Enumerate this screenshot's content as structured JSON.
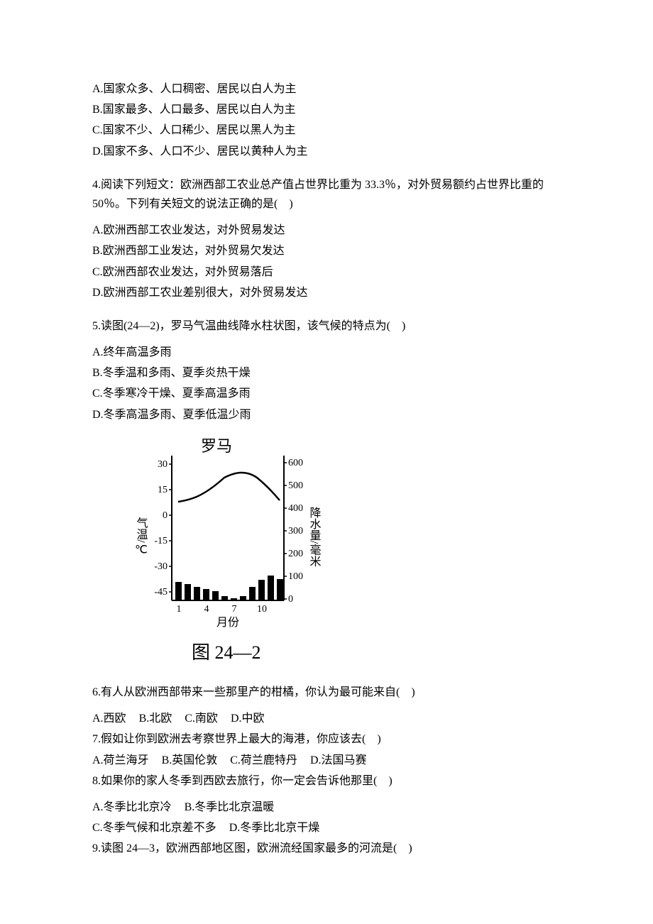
{
  "q3_options": {
    "A": "A.国家众多、人口稠密、居民以白人为主",
    "B": "B.国家最多、人口最多、居民以白人为主",
    "C": "C.国家不少、人口稀少、居民以黑人为主",
    "D": "D.国家不多、人口不少、居民以黄种人为主"
  },
  "q4": {
    "stem": "4.阅读下列短文：欧洲西部工农业总产值占世界比重为 33.3％，对外贸易额约占世界比重的 50％。下列有关短文的说法正确的是(　)",
    "A": "A.欧洲西部工农业发达，对外贸易发达",
    "B": "B.欧洲西部工业发达，对外贸易欠发达",
    "C": "C.欧洲西部农业发达，对外贸易落后",
    "D": "D.欧洲西部工农业差别很大，对外贸易发达"
  },
  "q5": {
    "stem": "5.读图(24—2)，罗马气温曲线降水柱状图，该气候的特点为(　)",
    "A": "A.终年高温多雨",
    "B": "B.冬季温和多雨、夏季炎热干燥",
    "C": "C.冬季寒冷干燥、夏季高温多雨",
    "D": "D.冬季高温多雨、夏季低温少雨"
  },
  "chart": {
    "title": "罗马",
    "caption": "图 24—2",
    "xlabel": "月份",
    "ylabel_left": "气温/℃",
    "ylabel_right": "降水量/毫米",
    "x_ticks": [
      "1",
      "4",
      "7",
      "10"
    ],
    "left_ticks": [
      "30",
      "15",
      "0",
      "-15",
      "-30",
      "-45"
    ],
    "right_ticks": [
      "600",
      "500",
      "400",
      "300",
      "200",
      "100",
      "0"
    ]
  },
  "chart_data": {
    "type": "bar",
    "title": "罗马",
    "xlabel": "月份",
    "ylabel_left": "气温/℃",
    "ylabel_right": "降水量/毫米",
    "categories": [
      1,
      2,
      3,
      4,
      5,
      6,
      7,
      8,
      9,
      10,
      11,
      12
    ],
    "series": [
      {
        "name": "气温",
        "axis": "left",
        "type": "line",
        "values": [
          8,
          9,
          11,
          14,
          18,
          22,
          25,
          25,
          22,
          17,
          13,
          9
        ]
      },
      {
        "name": "降水量",
        "axis": "right",
        "type": "bar",
        "values": [
          80,
          70,
          60,
          50,
          40,
          20,
          10,
          20,
          60,
          90,
          110,
          95
        ]
      }
    ],
    "left_range": [
      -45,
      30
    ],
    "right_range": [
      0,
      600
    ]
  },
  "q6": {
    "stem": "6.有人从欧洲西部带来一些那里产的柑橘，你认为最可能来自(　)",
    "A": "A.西欧",
    "B": "B.北欧",
    "C": "C.南欧",
    "D": "D.中欧"
  },
  "q7": {
    "stem": "7.假如让你到欧洲去考察世界上最大的海港，你应该去(　)",
    "A": "A.荷兰海牙",
    "B": "B.英国伦敦",
    "C": "C.荷兰鹿特丹",
    "D": "D.法国马赛"
  },
  "q8": {
    "stem": "8.如果你的家人冬季到西欧去旅行，你一定会告诉他那里(　)",
    "A": "A.冬季比北京冷",
    "B": "B.冬季比北京温暖",
    "C": "C.冬季气候和北京差不多",
    "D": "D.冬季比北京干燥"
  },
  "q9": {
    "stem": "9.读图 24—3，欧洲西部地区图，欧洲流经国家最多的河流是(　)"
  }
}
